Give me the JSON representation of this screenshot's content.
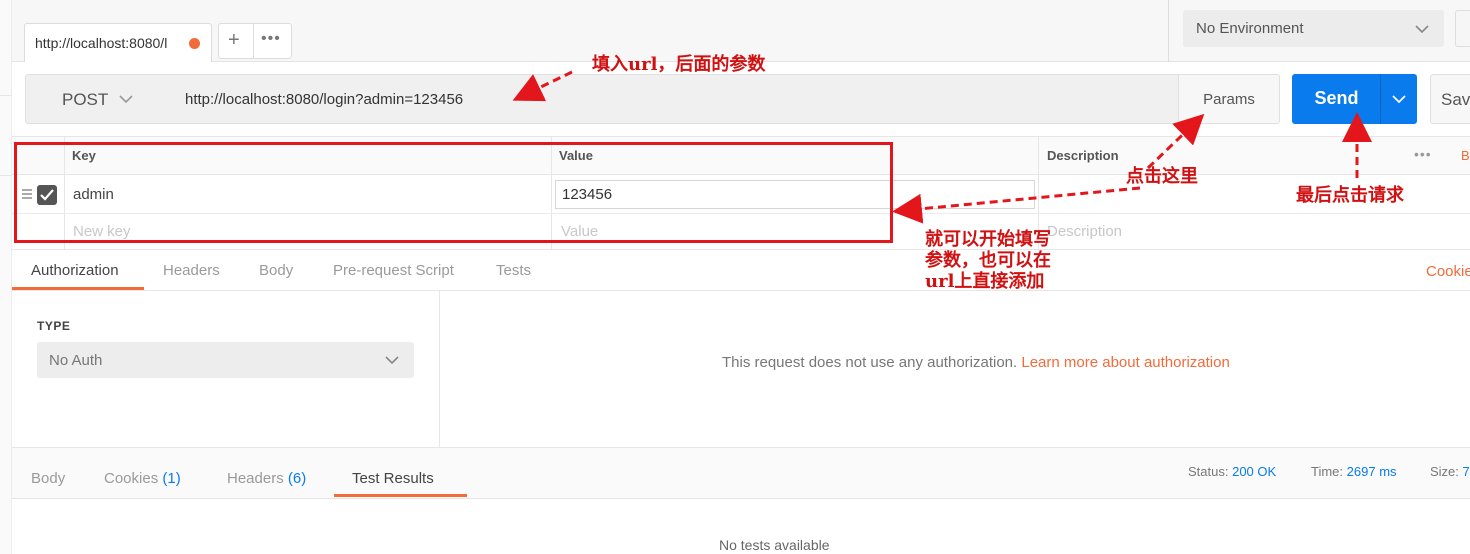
{
  "tabs": {
    "request_tab_label": "http://localhost:8080/l",
    "add_tab": "+",
    "more": "•••"
  },
  "environment": {
    "selected": "No Environment"
  },
  "request": {
    "method": "POST",
    "url": "http://localhost:8080/login?admin=123456",
    "params_label": "Params",
    "send_label": "Send",
    "save_label": "Sav"
  },
  "params_table": {
    "headers": [
      "Key",
      "Value",
      "Description"
    ],
    "bulk_more": "•••",
    "bulk_edit": "B",
    "rows": [
      {
        "key": "admin",
        "value": "123456",
        "checked": true
      }
    ],
    "new_key_placeholder": "New key",
    "new_value_placeholder": "Value",
    "description_placeholder": "Description"
  },
  "request_tabs": [
    "Authorization",
    "Headers",
    "Body",
    "Pre-request Script",
    "Tests"
  ],
  "cookies_link": "Cookie",
  "auth": {
    "type_label": "TYPE",
    "type_value": "No Auth",
    "message": "This request does not use any authorization. ",
    "learn_more": "Learn more about authorization"
  },
  "response": {
    "tabs": [
      {
        "label": "Body",
        "count": ""
      },
      {
        "label": "Cookies",
        "count": "(1)"
      },
      {
        "label": "Headers",
        "count": "(6)"
      },
      {
        "label": "Test Results",
        "count": ""
      }
    ],
    "status_label": "Status:",
    "status_value": "200 OK",
    "time_label": "Time:",
    "time_value": "2697 ms",
    "size_label": "Size:",
    "size_value": "7",
    "no_tests": "No tests available"
  },
  "annotations": {
    "url_note": "填入url，后面的参数",
    "params_note": "点击这里",
    "send_note": "最后点击请求",
    "table_note_line1": "就可以开始填写",
    "table_note_line2": "参数，也可以在",
    "table_note_line3": "url上直接添加"
  },
  "colors": {
    "accent": "#f26b3a",
    "send_blue": "#097bed",
    "annotation_red": "#e3161c"
  }
}
